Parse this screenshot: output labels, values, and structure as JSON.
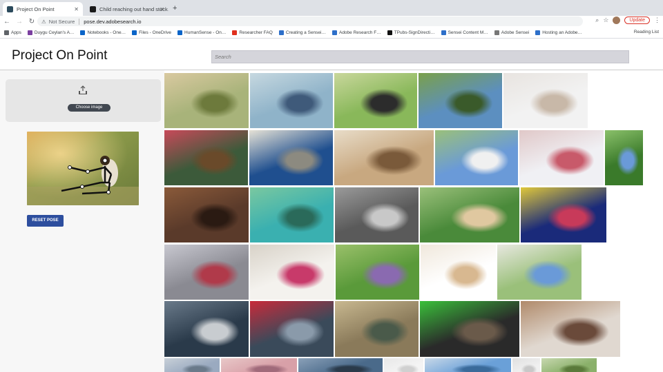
{
  "browser": {
    "tabs": [
      {
        "title": "Project On Point",
        "active": true,
        "favicon_color": "#2b4a5c"
      },
      {
        "title": "Child reaching out hand stock…",
        "active": false,
        "favicon_color": "#1a1a1a"
      }
    ],
    "new_tab_glyph": "+",
    "url_warning": "Not Secure",
    "url": "pose.dev.adobesearch.io",
    "update_label": "Update",
    "bookmarks": [
      {
        "label": "Apps",
        "icon": "apps-grid-icon",
        "color": "#5f6368"
      },
      {
        "label": "Duygu Ceylan's A…",
        "icon": "onenote-icon",
        "color": "#7b3fa0"
      },
      {
        "label": "Notebooks - One…",
        "icon": "onedrive-cloud-icon",
        "color": "#0a64c8"
      },
      {
        "label": "Files - OneDrive",
        "icon": "onedrive-cloud-icon",
        "color": "#0a64c8"
      },
      {
        "label": "HumanSense - On…",
        "icon": "onedrive-cloud-icon",
        "color": "#0a64c8"
      },
      {
        "label": "Researcher FAQ",
        "icon": "adobe-icon",
        "color": "#e0301e"
      },
      {
        "label": "Creating a Sensei…",
        "icon": "confluence-icon",
        "color": "#2d6fc9"
      },
      {
        "label": "Adobe Research F…",
        "icon": "confluence-icon",
        "color": "#2d6fc9"
      },
      {
        "label": "TPubs-SignDirecti…",
        "icon": "github-icon",
        "color": "#111111"
      },
      {
        "label": "Sensei Content M…",
        "icon": "confluence-icon",
        "color": "#2d6fc9"
      },
      {
        "label": "Adobe Sensei",
        "icon": "triangle-icon",
        "color": "#777777"
      },
      {
        "label": "Hosting an Adobe…",
        "icon": "confluence-icon",
        "color": "#2d6fc9"
      }
    ],
    "reading_list": "Reading List"
  },
  "app": {
    "title": "Project On Point",
    "search_placeholder": "Search",
    "choose_image_label": "Choose image",
    "reset_pose_label": "RESET POSE"
  },
  "gallery": {
    "rows": [
      [
        {
          "desc": "girl sitting cross-legged in nature",
          "colors": [
            "#a8b37a",
            "#d9c9a0",
            "#6d7a3c"
          ]
        },
        {
          "desc": "woman in denim sitting on ground with hat",
          "colors": [
            "#8fb3c9",
            "#c6d8e0",
            "#3f5a7a"
          ]
        },
        {
          "desc": "woman sitting on grass with laptop",
          "colors": [
            "#89b85a",
            "#c9d79c",
            "#2c2c2c"
          ]
        },
        {
          "desc": "man sitting on hill by the sea",
          "colors": [
            "#5c8fc0",
            "#7aa04a",
            "#3a5a2a"
          ]
        },
        {
          "desc": "woman in white sitting on floor",
          "colors": [
            "#f2f2f2",
            "#e8e4e0",
            "#c8b8a8"
          ]
        }
      ],
      [
        {
          "desc": "girl with christmas gifts",
          "colors": [
            "#3c5a3a",
            "#c84a5a",
            "#6a4a2a"
          ]
        },
        {
          "desc": "marble sculpture group",
          "colors": [
            "#1f4f8f",
            "#e6e2d6",
            "#8c8a80"
          ]
        },
        {
          "desc": "children playing on wooden floor",
          "colors": [
            "#c8a880",
            "#e8dcc8",
            "#7a5a3a"
          ]
        },
        {
          "desc": "woman sitting under blue sky",
          "colors": [
            "#6a9ad8",
            "#9ac07a",
            "#f0f0f0"
          ]
        },
        {
          "desc": "children on bed with toys",
          "colors": [
            "#f0f0f4",
            "#e0c8c8",
            "#c85a6a"
          ]
        },
        {
          "desc": "child in park",
          "colors": [
            "#3a7a2a",
            "#8ac06a",
            "#6a9ad8"
          ]
        }
      ],
      [
        {
          "desc": "girl on dark stairs",
          "colors": [
            "#5a3a2a",
            "#8a5a3a",
            "#2a1a12"
          ]
        },
        {
          "desc": "woman in pool with float",
          "colors": [
            "#3ab0b0",
            "#7ac8a0",
            "#2a6a5a"
          ]
        },
        {
          "desc": "woman near waterfall on rocks",
          "colors": [
            "#5a5a5a",
            "#9a9a9a",
            "#c8c8c8"
          ]
        },
        {
          "desc": "women with laptop in park",
          "colors": [
            "#4a8a3a",
            "#9ac07a",
            "#e0c8a0"
          ]
        },
        {
          "desc": "children on colorful cushions at night",
          "colors": [
            "#1a2a7a",
            "#e0c83a",
            "#c83a5a"
          ]
        }
      ],
      [
        {
          "desc": "woman reading on blanket with tea",
          "colors": [
            "#8a8a92",
            "#c8c8d0",
            "#b03a4a"
          ]
        },
        {
          "desc": "woman with book on white sofa",
          "colors": [
            "#f4f2ee",
            "#d8d2c8",
            "#c83a6a"
          ]
        },
        {
          "desc": "woman reading on grass",
          "colors": [
            "#5a9a3a",
            "#9ac06a",
            "#8a6ab0"
          ]
        },
        {
          "desc": "woman sitting reading on white",
          "colors": [
            "#ffffff",
            "#f0e8dc",
            "#d8b890"
          ]
        },
        {
          "desc": "woman on blanket outdoors",
          "colors": [
            "#9ac07a",
            "#e8e8e0",
            "#6a9ad8"
          ]
        }
      ],
      [
        {
          "desc": "man in car interior",
          "colors": [
            "#2a3a4a",
            "#6a7a8a",
            "#c8ccd0"
          ]
        },
        {
          "desc": "woman on red couch in sea",
          "colors": [
            "#3a4a5a",
            "#c82a3a",
            "#8a9aaa"
          ]
        },
        {
          "desc": "elderly man in wheat field",
          "colors": [
            "#8a7a5a",
            "#c8b890",
            "#4a5a4a"
          ]
        },
        {
          "desc": "man with green screen tv",
          "colors": [
            "#2a2a2a",
            "#3ac03a",
            "#6a5a4a"
          ]
        },
        {
          "desc": "collage of friends photos",
          "colors": [
            "#e0d8d0",
            "#b08a6a",
            "#6a4a3a"
          ]
        }
      ],
      [
        {
          "desc": "row partially visible 1",
          "colors": [
            "#9aaac0",
            "#c8d0d8",
            "#6a7a8a"
          ]
        },
        {
          "desc": "row partially visible 2",
          "colors": [
            "#d8a0a8",
            "#e8c8c8",
            "#a06a7a"
          ]
        },
        {
          "desc": "row partially visible 3",
          "colors": [
            "#4a6a8a",
            "#8aa0b8",
            "#2a3a4a"
          ]
        },
        {
          "desc": "row partially visible 4",
          "colors": [
            "#f4f4f4",
            "#e8e8e8",
            "#d0d0d0"
          ]
        },
        {
          "desc": "row partially visible 5",
          "colors": [
            "#6aa0d8",
            "#c8d8e8",
            "#3a6a9a"
          ]
        },
        {
          "desc": "row partially visible 6",
          "colors": [
            "#f0f0f0",
            "#e0e0e0",
            "#c8c8c8"
          ]
        },
        {
          "desc": "row partially visible 7",
          "colors": [
            "#8ab06a",
            "#c8d8b0",
            "#5a7a3a"
          ]
        }
      ]
    ]
  }
}
